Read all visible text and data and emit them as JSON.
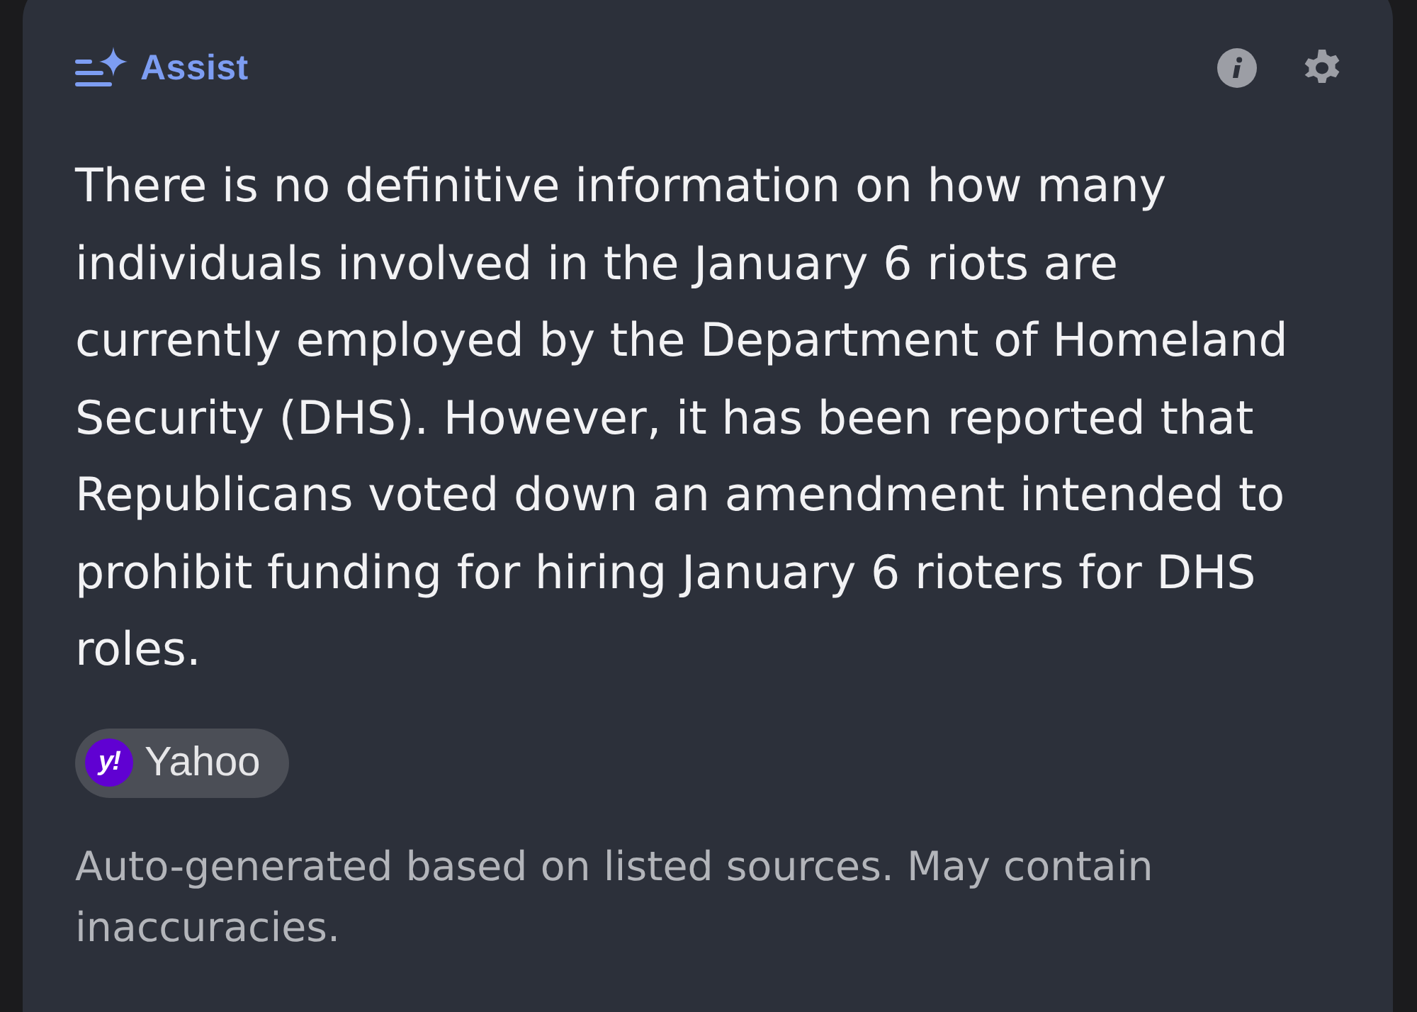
{
  "header": {
    "title": "Assist"
  },
  "answer": "There is no definitive information on how many individuals involved in the January 6 riots are currently employed by the Department of Homeland Security (DHS). However, it has been reported that Republicans voted down an amendment intended to prohibit funding for hiring January 6 rioters for DHS roles.",
  "sources": [
    {
      "name": "Yahoo",
      "logo_text": "y!"
    }
  ],
  "disclaimer": "Auto-generated based on listed sources. May contain inaccuracies."
}
